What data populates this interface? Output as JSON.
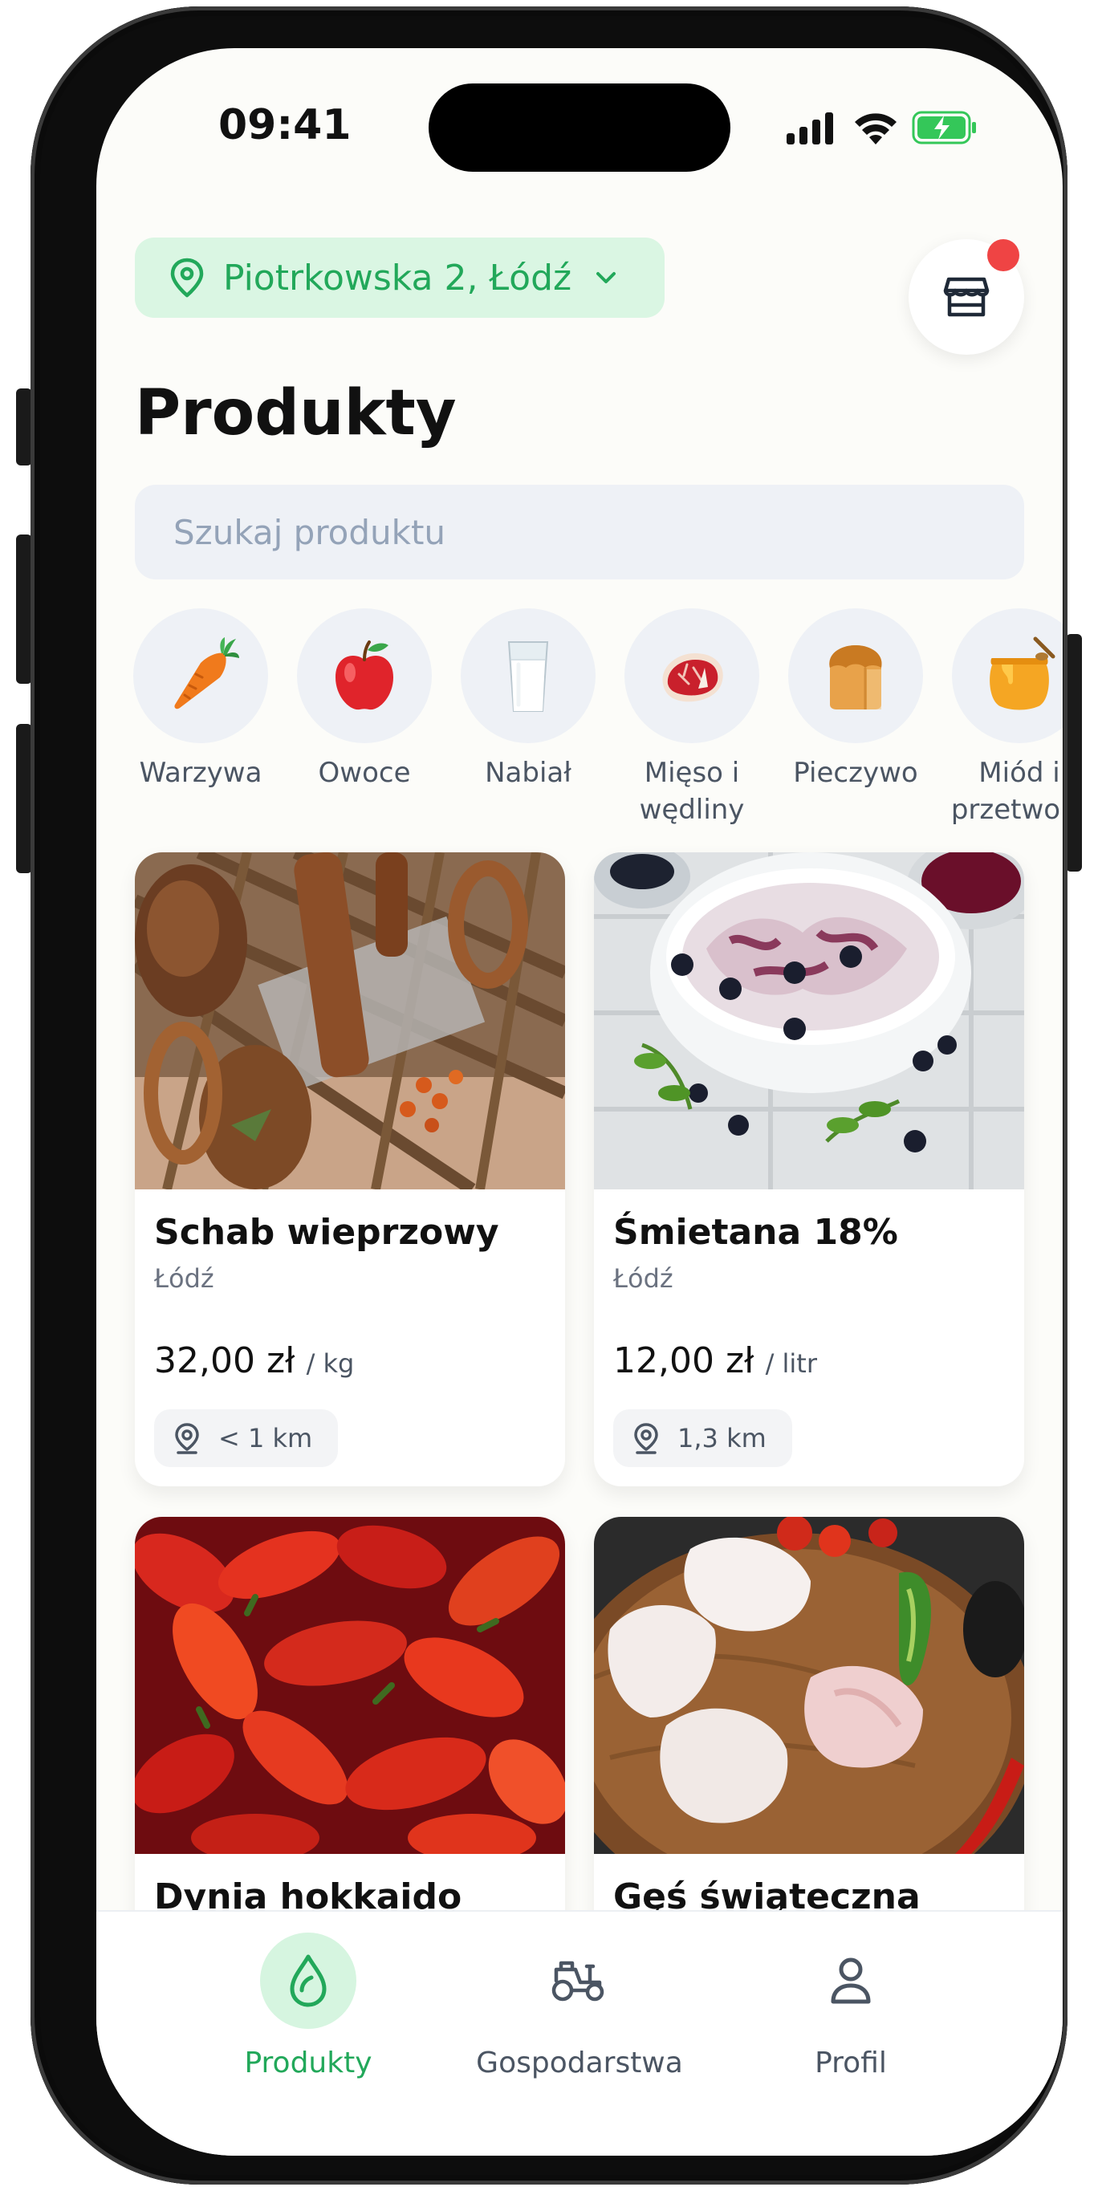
{
  "status_bar": {
    "time": "09:41"
  },
  "location": {
    "text": "Piotrkowska 2, Łódź"
  },
  "page_title": "Produkty",
  "search": {
    "placeholder": "Szukaj produktu"
  },
  "categories": [
    {
      "label": "Warzywa",
      "emoji": "🥕",
      "icon": "carrot-icon"
    },
    {
      "label": "Owoce",
      "emoji": "🍎",
      "icon": "apple-icon"
    },
    {
      "label": "Nabiał",
      "emoji": "🥛",
      "icon": "milk-icon"
    },
    {
      "label": "Mięso i wędliny",
      "emoji": "🥩",
      "icon": "meat-icon"
    },
    {
      "label": "Pieczywo",
      "emoji": "🍞",
      "icon": "bread-icon"
    },
    {
      "label": "Miód i przetwory",
      "emoji": "🍯",
      "icon": "honey-icon"
    }
  ],
  "products": [
    {
      "name": "Schab wieprzowy",
      "city": "Łódź",
      "price": "32,00 zł",
      "unit": "/ kg",
      "distance": "< 1 km",
      "image": "smoked-meats-photo"
    },
    {
      "name": "Śmietana 18%",
      "city": "Łódź",
      "price": "12,00 zł",
      "unit": "/ litr",
      "distance": "1,3 km",
      "image": "blueberry-cream-photo"
    },
    {
      "name": "Dynia hokkaido",
      "city": "",
      "price": "",
      "unit": "",
      "distance": "",
      "image": "red-peppers-photo"
    },
    {
      "name": "Gęś świąteczna",
      "city": "",
      "price": "",
      "unit": "",
      "distance": "",
      "image": "raw-goose-photo"
    }
  ],
  "bottom_nav": [
    {
      "label": "Produkty",
      "icon": "drop-icon",
      "active": true
    },
    {
      "label": "Gospodarstwa",
      "icon": "tractor-icon",
      "active": false
    },
    {
      "label": "Profil",
      "icon": "user-icon",
      "active": false
    }
  ],
  "colors": {
    "accent_green": "#22a85a",
    "pill_bg": "#daf6e3",
    "notification_red": "#ef4444",
    "battery_green": "#34c759"
  }
}
